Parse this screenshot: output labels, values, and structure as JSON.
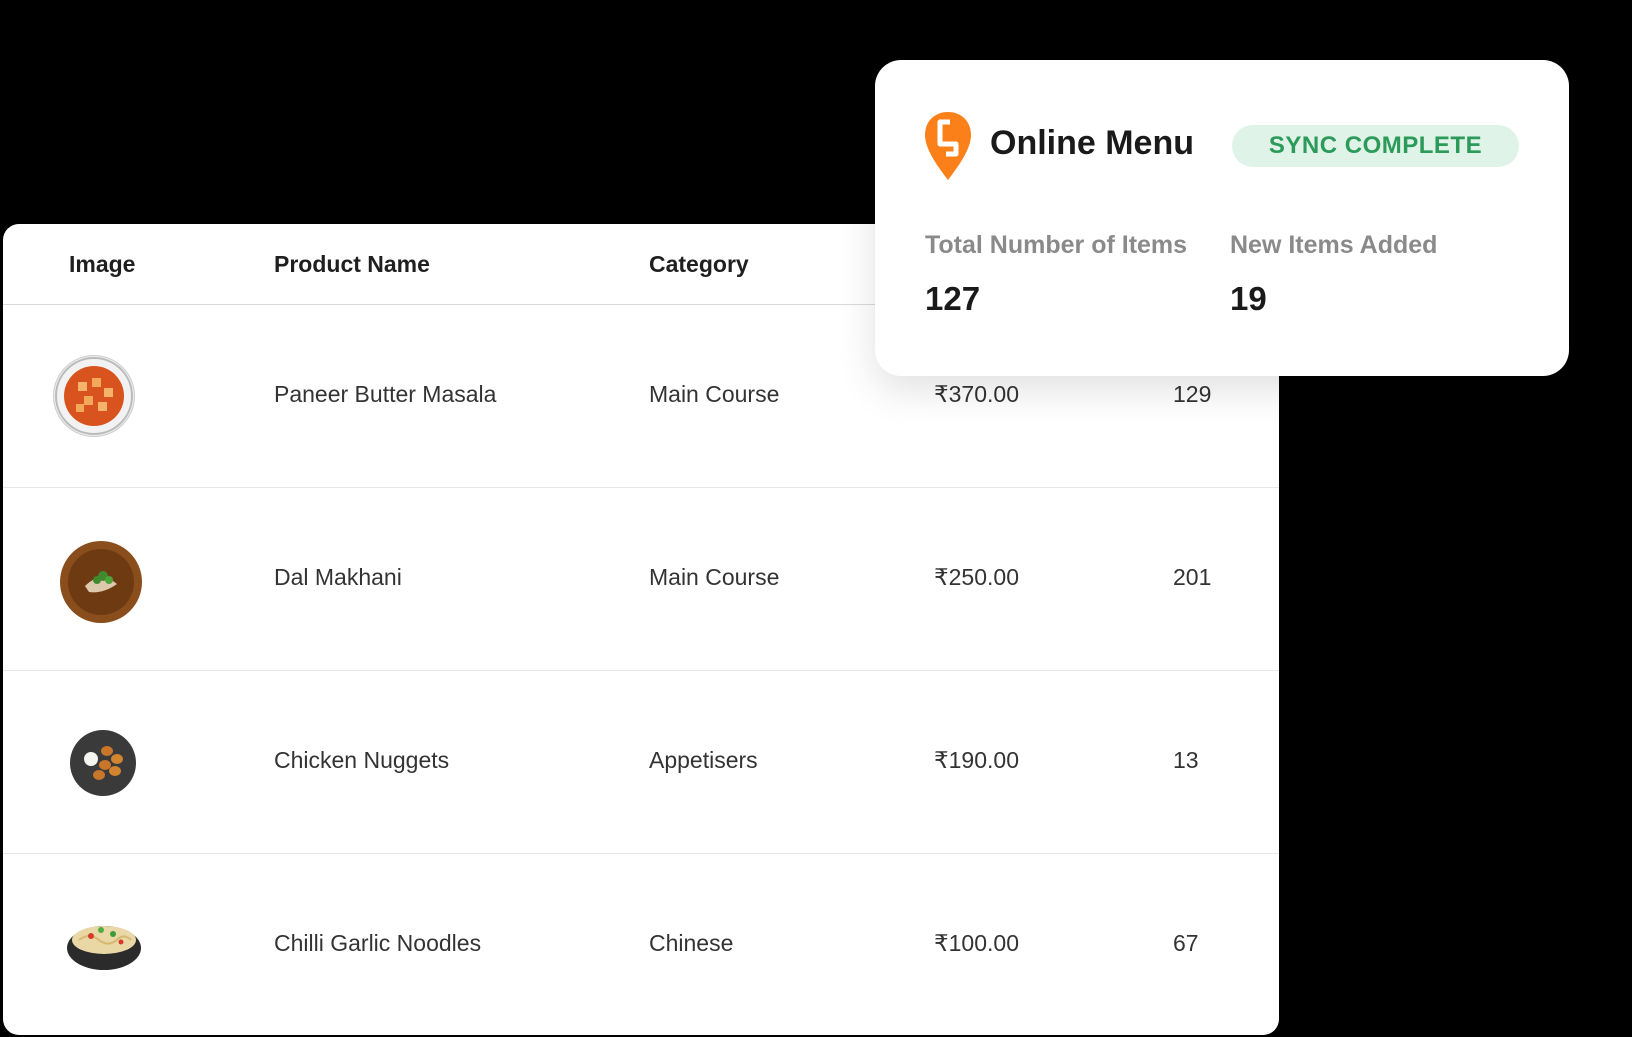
{
  "table": {
    "headers": {
      "image": "Image",
      "product_name": "Product Name",
      "category": "Category"
    },
    "rows": [
      {
        "image_icon": "paneer-butter-masala-photo",
        "name": "Paneer Butter Masala",
        "category": "Main Course",
        "price": "₹370.00",
        "count": "129"
      },
      {
        "image_icon": "dal-makhani-photo",
        "name": "Dal Makhani",
        "category": "Main Course",
        "price": "₹250.00",
        "count": "201"
      },
      {
        "image_icon": "chicken-nuggets-photo",
        "name": "Chicken Nuggets",
        "category": "Appetisers",
        "price": "₹190.00",
        "count": "13"
      },
      {
        "image_icon": "chilli-garlic-noodles-photo",
        "name": "Chilli Garlic Noodles",
        "category": "Chinese",
        "price": "₹100.00",
        "count": "67"
      }
    ]
  },
  "sync_card": {
    "logo_icon": "swiggy-logo-icon",
    "title": "Online Menu",
    "status_badge": "SYNC COMPLETE",
    "stats": [
      {
        "label": "Total Number of Items",
        "value": "127"
      },
      {
        "label": "New Items Added",
        "value": "19"
      }
    ]
  },
  "colors": {
    "background": "#000000",
    "brand_orange": "#fc8019",
    "badge_bg": "#dff3e8",
    "badge_text": "#2c9a58"
  }
}
